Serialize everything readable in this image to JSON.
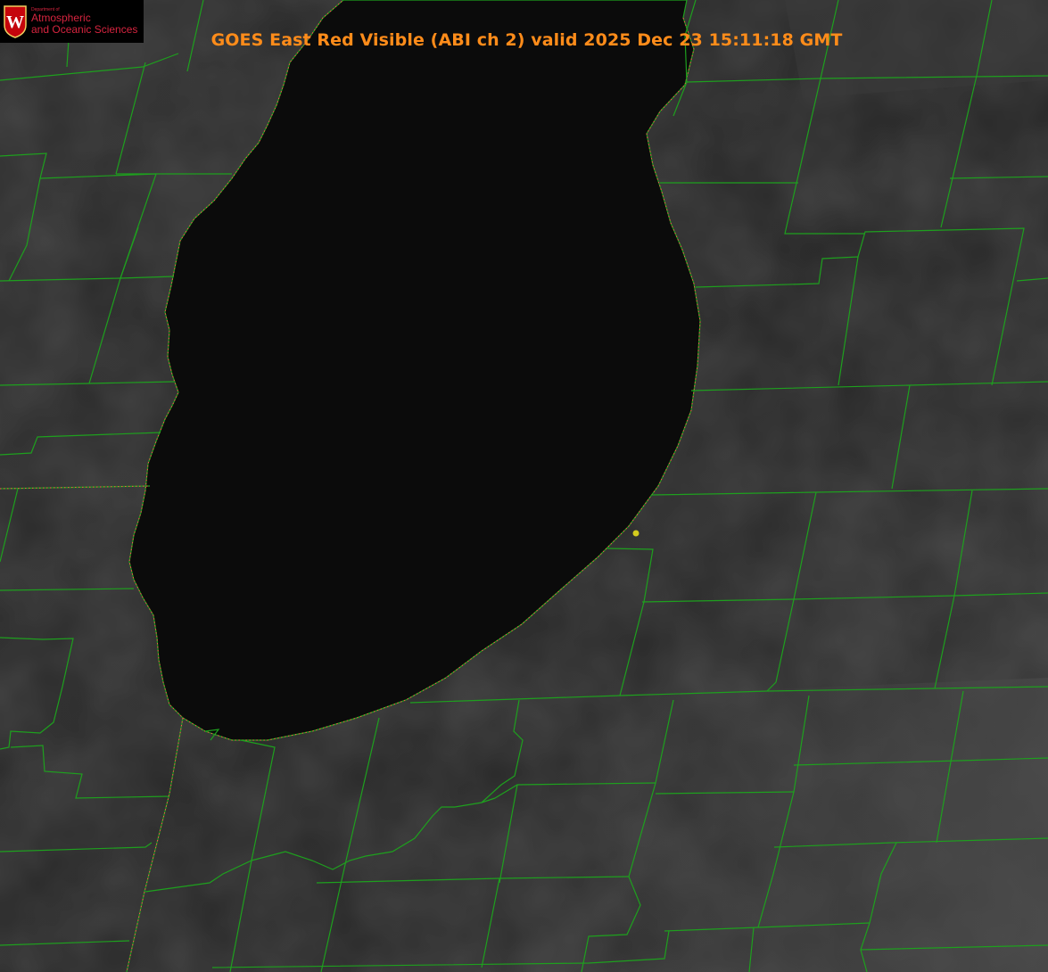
{
  "header": {
    "title": "GOES East Red Visible (ABI ch 2) valid 2025 Dec 23 15:11:18 GMT"
  },
  "logo": {
    "department_line": "Department of",
    "line1": "Atmospheric",
    "line2": "and Oceanic Sciences",
    "crest_letter": "W"
  },
  "colors": {
    "land": "#2a2a2a",
    "lake": "#0b0b0b",
    "county_lines": "#1ea01e",
    "state_lines": "#ff4d4d",
    "title": "#ff8c1a",
    "logo_text": "#d6243f",
    "station_marker": "#d4cc1e"
  },
  "map": {
    "imagery": "visible satellite imagery",
    "water_body": "lake",
    "overlays": [
      "county-boundaries",
      "state-boundaries",
      "station-marker"
    ]
  }
}
